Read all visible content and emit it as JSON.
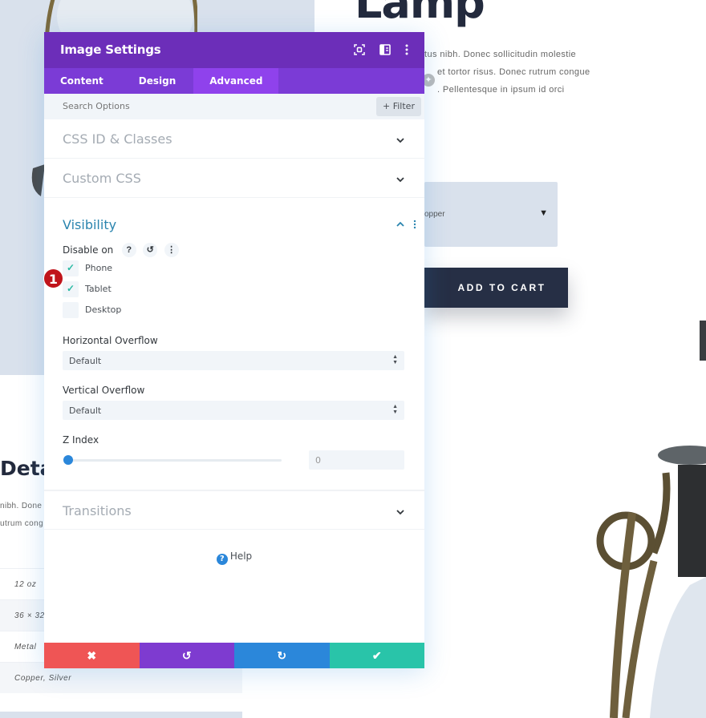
{
  "background": {
    "product_title": "Lamp",
    "paragraph_lines": [
      "tus nibh. Donec sollicitudin molestie",
      "et tortor risus. Donec rutrum congue",
      ". Pellentesque in ipsum id orci"
    ],
    "variant_select_value": "opper",
    "add_to_cart_label": "ADD TO CART",
    "details_heading": "Deta",
    "details_lines": [
      "nibh. Done",
      "utrum cong"
    ],
    "spec_rows": [
      "12 oz",
      "36 × 32",
      "Metal",
      "Copper, Silver"
    ]
  },
  "modal": {
    "title": "Image Settings",
    "header_icons": [
      "expand-icon",
      "split-view-icon",
      "more-options-icon"
    ],
    "tabs": [
      {
        "label": "Content",
        "active": false
      },
      {
        "label": "Design",
        "active": false
      },
      {
        "label": "Advanced",
        "active": true
      }
    ],
    "search_placeholder": "Search Options",
    "filter_label": "+ Filter",
    "sections": {
      "css_id_classes": "CSS ID & Classes",
      "custom_css": "Custom CSS",
      "visibility": "Visibility",
      "transitions": "Transitions"
    },
    "visibility": {
      "disable_on_label": "Disable on",
      "devices": [
        {
          "label": "Phone",
          "checked": true
        },
        {
          "label": "Tablet",
          "checked": true
        },
        {
          "label": "Desktop",
          "checked": false
        }
      ],
      "horizontal_overflow_label": "Horizontal Overflow",
      "horizontal_overflow_value": "Default",
      "vertical_overflow_label": "Vertical Overflow",
      "vertical_overflow_value": "Default",
      "z_index_label": "Z Index",
      "z_index_value": "0",
      "z_index_slider_fraction": 0
    },
    "help_label": "Help",
    "footer_buttons": [
      {
        "name": "cancel",
        "glyph": "✖",
        "color": "#ef5555"
      },
      {
        "name": "undo",
        "glyph": "↺",
        "color": "#7e3bd0"
      },
      {
        "name": "redo",
        "glyph": "↻",
        "color": "#2b87da"
      },
      {
        "name": "save",
        "glyph": "✔",
        "color": "#29c4a9"
      }
    ]
  },
  "annotation_badge": "1",
  "colors": {
    "header_purple": "#6c2eb9",
    "tab_purple": "#7b3bd6",
    "active_tab": "#8f42ec",
    "visibility_blue": "#2a84ae",
    "check_teal": "#2abaa4",
    "slider_blue": "#2b87da",
    "dark_navy": "#262f45"
  }
}
